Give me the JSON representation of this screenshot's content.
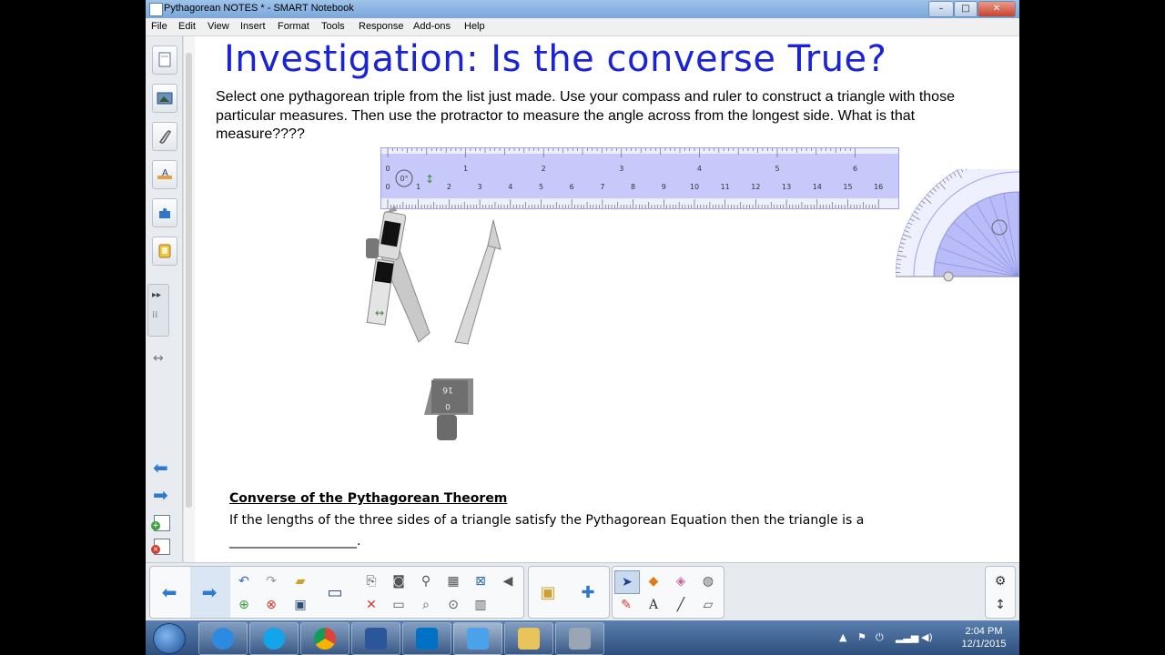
{
  "window": {
    "title": "Pythagorean NOTES * - SMART Notebook",
    "controls": {
      "minimize": "–",
      "maximize": "□",
      "close": "✕"
    }
  },
  "menubar": {
    "items": [
      "File",
      "Edit",
      "View",
      "Insert",
      "Format",
      "Tools",
      "Response",
      "Add-ons",
      "Help"
    ]
  },
  "page": {
    "heading": "Investigation: Is the converse True?",
    "instructions": "Select one pythagorean triple from the list just made.  Use your compass and ruler to construct a triangle with those particular measures.  Then use the protractor to measure the angle across from the longest side.  What is that measure????",
    "ruler": {
      "angle_label": "0°",
      "inch_labels": [
        "0",
        "1",
        "2",
        "3",
        "4",
        "5",
        "6"
      ],
      "cm_labels": [
        "0",
        "1",
        "2",
        "3",
        "4",
        "5",
        "6",
        "7",
        "8",
        "9",
        "10",
        "11",
        "12",
        "13",
        "14",
        "15",
        "16"
      ]
    },
    "compass": {
      "label_a": "16",
      "label_b": "0"
    },
    "converse": {
      "title": "Converse of the Pythagorean Theorem",
      "text": "If the lengths of the three sides of a triangle satisfy the Pythagorean Equation then the triangle is a",
      "blank": "____________________."
    }
  },
  "taskbar": {
    "time": "2:04 PM",
    "date": "12/1/2015",
    "apps": [
      "internet-explorer",
      "skype",
      "chrome",
      "word",
      "outlook",
      "smart-notebook",
      "file-explorer",
      "document-camera"
    ]
  },
  "colors": {
    "heading": "#1a23d6",
    "ruler": "#c7c9fa",
    "protractor": "#b9bcf7",
    "titlebar": "#8fb6e3"
  }
}
